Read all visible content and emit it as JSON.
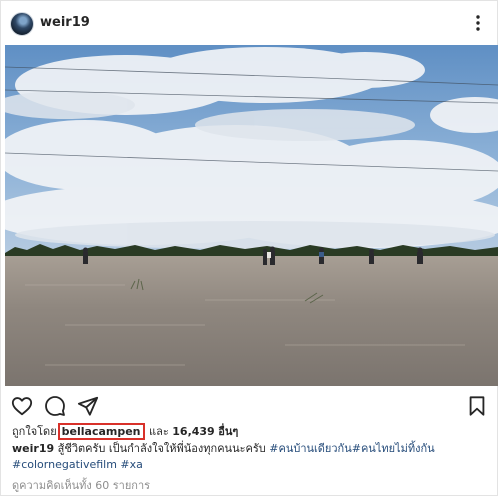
{
  "post": {
    "username": "weir19",
    "likes": {
      "prefix": "ถูกใจโดย",
      "highlighted_user": "bellacampen",
      "suffix": "และ",
      "count": "16,439",
      "count_suffix": "อื่นๆ"
    },
    "caption": {
      "username": "weir19",
      "text": "สู้ชีวิตครับ เป็นกำลังใจให้พี่น้องทุกคนนะครับ",
      "hashtags": [
        "#คนบ้านเดียวกัน",
        "#คนไทยไม่ทิ้งกัน",
        "#colornegativefilm",
        "#xa"
      ]
    },
    "comments_link": "ดูความคิดเห็นทั้ง 60 รายการ"
  },
  "icons": {
    "more": "more-options-icon",
    "like": "heart-icon",
    "comment": "comment-icon",
    "share": "share-icon",
    "save": "bookmark-icon"
  },
  "colors": {
    "text": "#262626",
    "hashtag": "#264c7a",
    "muted": "#8e8e8e",
    "highlight_border": "#d8312a"
  }
}
